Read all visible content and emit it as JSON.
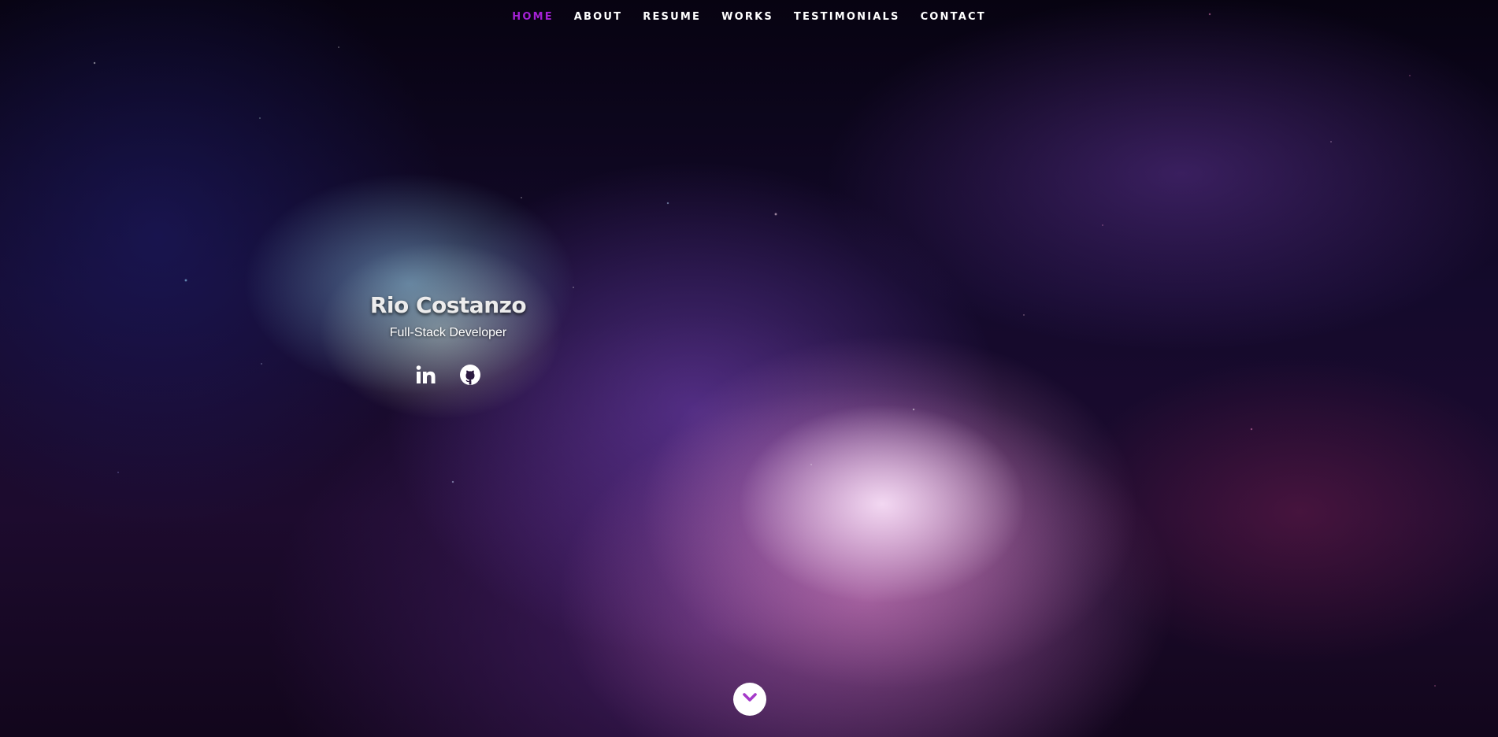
{
  "nav": {
    "items": [
      {
        "label": "HOME",
        "active": true
      },
      {
        "label": "ABOUT",
        "active": false
      },
      {
        "label": "RESUME",
        "active": false
      },
      {
        "label": "WORKS",
        "active": false
      },
      {
        "label": "TESTIMONIALS",
        "active": false
      },
      {
        "label": "CONTACT",
        "active": false
      }
    ],
    "active_color": "#a521d6",
    "text_color": "#ffffff"
  },
  "hero": {
    "name": "Rio Costanzo",
    "role": "Full-Stack Developer",
    "socials": [
      {
        "icon": "linkedin-icon"
      },
      {
        "icon": "github-icon"
      }
    ]
  },
  "scroll_button": {
    "icon": "chevron-down-icon"
  }
}
